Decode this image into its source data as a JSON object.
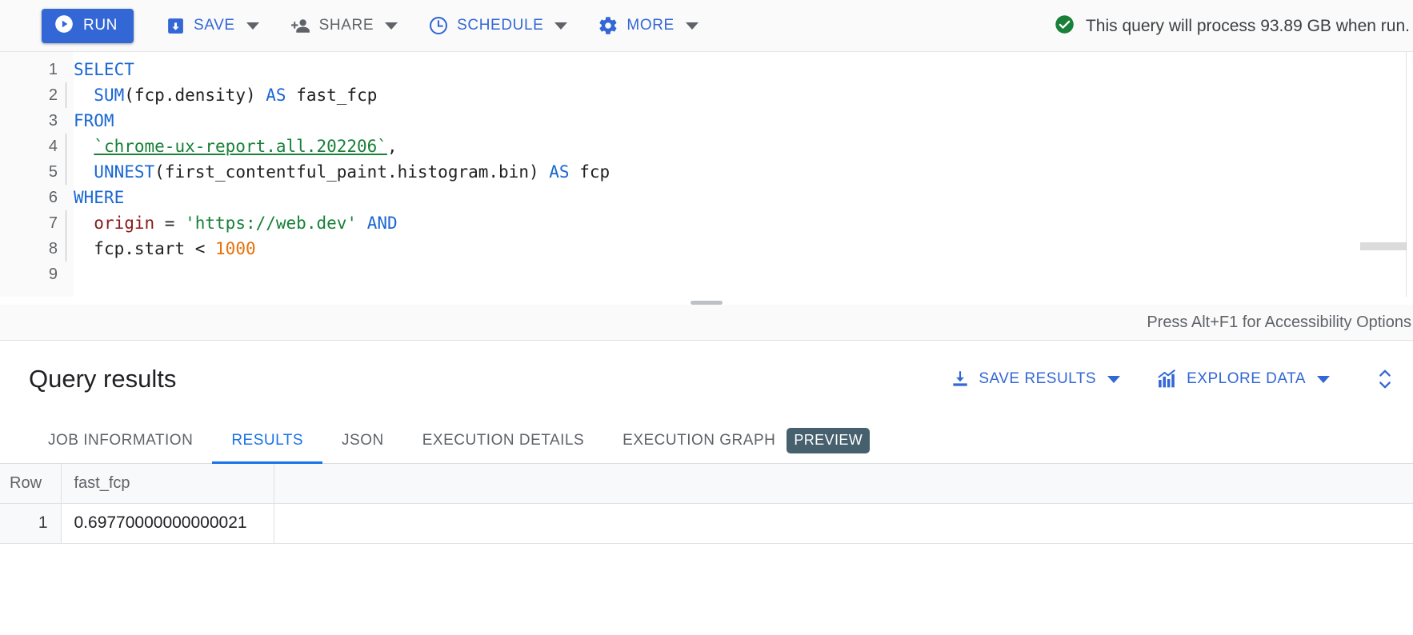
{
  "toolbar": {
    "run_label": "RUN",
    "save_label": "SAVE",
    "share_label": "SHARE",
    "schedule_label": "SCHEDULE",
    "more_label": "MORE",
    "status_text": "This query will process 93.89 GB when run.",
    "accent_color": "#3367d6",
    "status_icon_color": "#188038"
  },
  "editor": {
    "accessibility_hint": "Press Alt+F1 for Accessibility Options",
    "lines": [
      {
        "no": "1",
        "indent": false,
        "tokens": [
          {
            "t": "SELECT",
            "c": "kw"
          }
        ]
      },
      {
        "no": "2",
        "indent": true,
        "tokens": [
          {
            "t": "  ",
            "c": "id"
          },
          {
            "t": "SUM",
            "c": "fn"
          },
          {
            "t": "(",
            "c": "punct"
          },
          {
            "t": "fcp.density",
            "c": "id"
          },
          {
            "t": ")",
            "c": "punct"
          },
          {
            "t": " ",
            "c": "id"
          },
          {
            "t": "AS",
            "c": "kw"
          },
          {
            "t": " fast_fcp",
            "c": "id"
          }
        ]
      },
      {
        "no": "3",
        "indent": false,
        "tokens": [
          {
            "t": "FROM",
            "c": "kw"
          }
        ]
      },
      {
        "no": "4",
        "indent": true,
        "tokens": [
          {
            "t": "  ",
            "c": "id"
          },
          {
            "t": "`chrome-ux-report.all.202206`",
            "c": "tbl"
          },
          {
            "t": ",",
            "c": "punct"
          }
        ]
      },
      {
        "no": "5",
        "indent": true,
        "tokens": [
          {
            "t": "  ",
            "c": "id"
          },
          {
            "t": "UNNEST",
            "c": "fn"
          },
          {
            "t": "(",
            "c": "punct"
          },
          {
            "t": "first_contentful_paint.histogram.bin",
            "c": "id"
          },
          {
            "t": ")",
            "c": "punct"
          },
          {
            "t": " ",
            "c": "id"
          },
          {
            "t": "AS",
            "c": "kw"
          },
          {
            "t": " fcp",
            "c": "id"
          }
        ]
      },
      {
        "no": "6",
        "indent": false,
        "tokens": [
          {
            "t": "WHERE",
            "c": "kw"
          }
        ]
      },
      {
        "no": "7",
        "indent": true,
        "tokens": [
          {
            "t": "  ",
            "c": "id"
          },
          {
            "t": "origin",
            "c": "col"
          },
          {
            "t": " = ",
            "c": "punct"
          },
          {
            "t": "'",
            "c": "str"
          },
          {
            "t": "https://web.dev",
            "c": "str u"
          },
          {
            "t": "'",
            "c": "str"
          },
          {
            "t": " ",
            "c": "id"
          },
          {
            "t": "AND",
            "c": "kw"
          }
        ]
      },
      {
        "no": "8",
        "indent": true,
        "tokens": [
          {
            "t": "  ",
            "c": "id"
          },
          {
            "t": "fcp.start",
            "c": "id"
          },
          {
            "t": " < ",
            "c": "punct"
          },
          {
            "t": "1000",
            "c": "num"
          }
        ]
      },
      {
        "no": "9",
        "indent": false,
        "tokens": []
      }
    ]
  },
  "results": {
    "title": "Query results",
    "save_results_label": "SAVE RESULTS",
    "explore_data_label": "EXPLORE DATA",
    "tabs": [
      {
        "label": "JOB INFORMATION",
        "active": false,
        "badge": ""
      },
      {
        "label": "RESULTS",
        "active": true,
        "badge": ""
      },
      {
        "label": "JSON",
        "active": false,
        "badge": ""
      },
      {
        "label": "EXECUTION DETAILS",
        "active": false,
        "badge": ""
      },
      {
        "label": "EXECUTION GRAPH",
        "active": false,
        "badge": "PREVIEW"
      }
    ],
    "table": {
      "columns": [
        "Row",
        "fast_fcp",
        ""
      ],
      "rows": [
        {
          "row": "1",
          "fast_fcp": "0.69770000000000021"
        }
      ]
    }
  }
}
